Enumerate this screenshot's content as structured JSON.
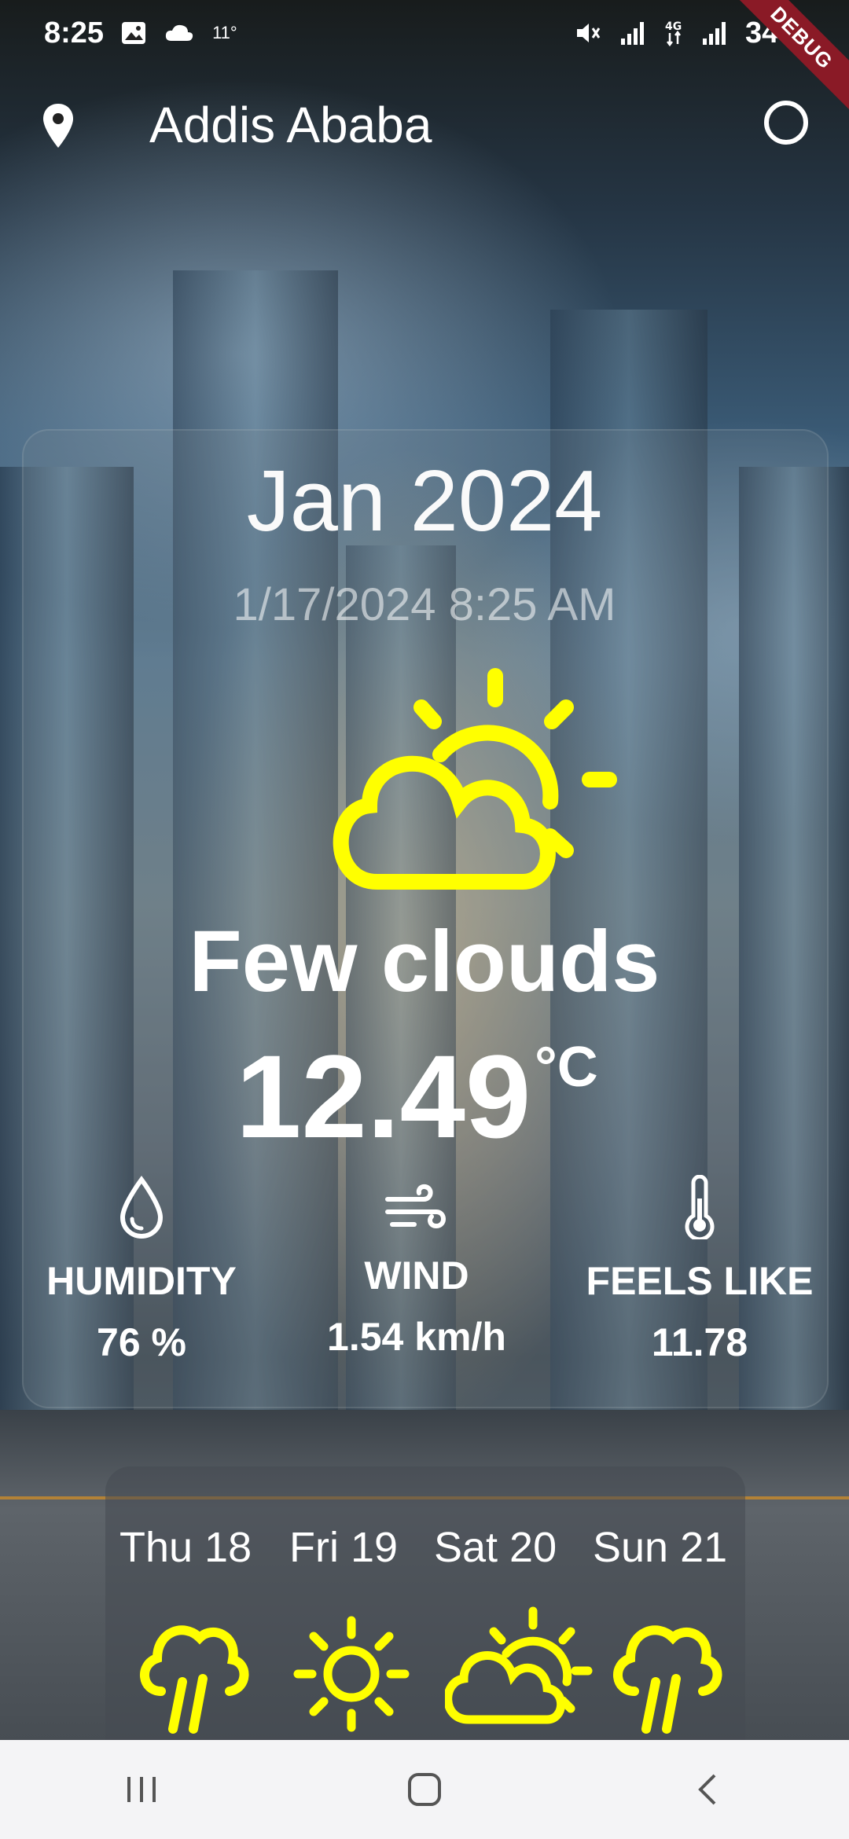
{
  "status_bar": {
    "time": "8:25",
    "small_temp": "11°",
    "battery": "34%",
    "debug_label": "DEBUG"
  },
  "app_bar": {
    "city": "Addis Ababa"
  },
  "current": {
    "month_year": "Jan 2024",
    "datetime": "1/17/2024 8:25 AM",
    "condition": "Few clouds",
    "temperature": "12.49",
    "unit": "°C"
  },
  "stats": {
    "humidity": {
      "label": "HUMIDITY",
      "value": "76 %"
    },
    "wind": {
      "label": "WIND",
      "value": "1.54 km/h"
    },
    "feels_like": {
      "label": "FEELS LIKE",
      "value": "11.78"
    }
  },
  "forecast": [
    {
      "day": "Thu 18",
      "icon": "rain-cloud-icon"
    },
    {
      "day": "Fri 19",
      "icon": "sun-icon"
    },
    {
      "day": "Sat 20",
      "icon": "partly-cloudy-icon"
    },
    {
      "day": "Sun 21",
      "icon": "rain-cloud-icon"
    }
  ],
  "colors": {
    "accent_yellow": "#FFFF00",
    "debug_banner": "#8A1A26"
  }
}
